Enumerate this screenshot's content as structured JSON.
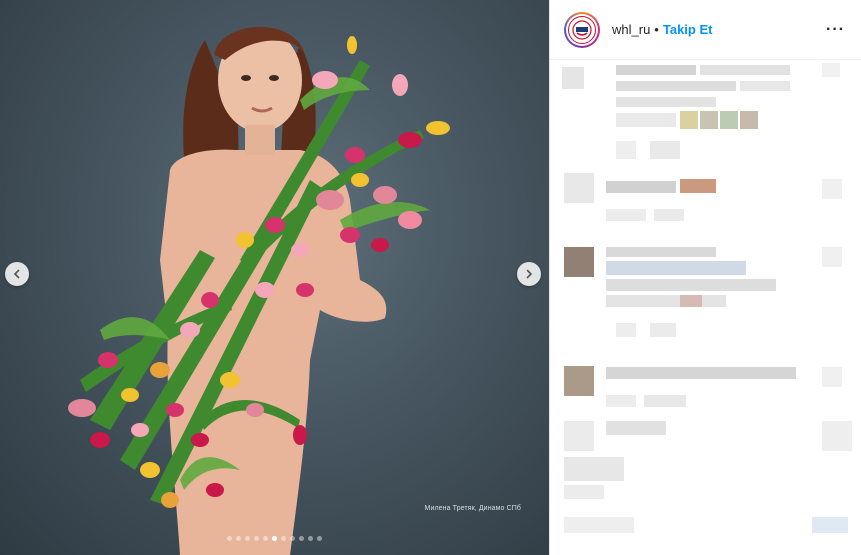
{
  "post": {
    "caption": "Милена Третяк, Динамо СПб",
    "carousel": {
      "total": 11,
      "active_index": 5
    }
  },
  "header": {
    "username": "whl_ru",
    "separator": "•",
    "follow_label": "Takip Et",
    "more_label": "···"
  },
  "icons": {
    "prev": "chevron-left-icon",
    "next": "chevron-right-icon",
    "options": "more-horizontal-icon"
  },
  "colors": {
    "follow": "#0095f6",
    "background_photo": "#46555f"
  }
}
